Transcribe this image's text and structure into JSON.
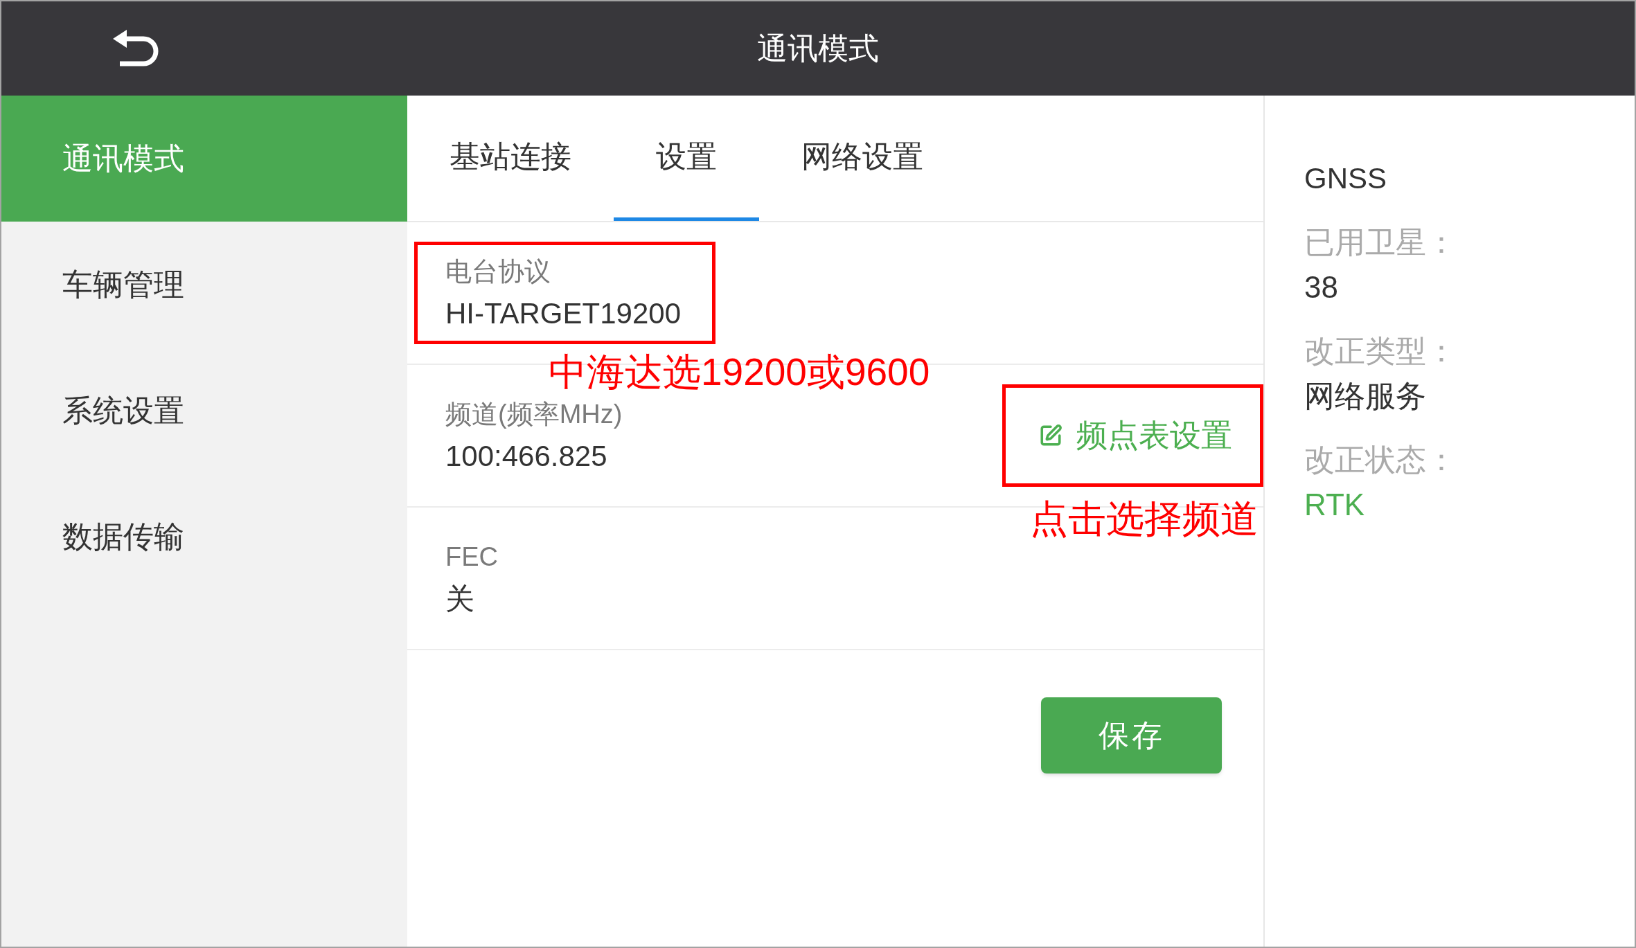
{
  "header": {
    "title": "通讯模式"
  },
  "sidebar": {
    "items": [
      {
        "label": "通讯模式",
        "selected": true
      },
      {
        "label": "车辆管理",
        "selected": false
      },
      {
        "label": "系统设置",
        "selected": false
      },
      {
        "label": "数据传输",
        "selected": false
      }
    ]
  },
  "tabs": [
    {
      "label": "基站连接",
      "selected": false
    },
    {
      "label": "设置",
      "selected": true
    },
    {
      "label": "网络设置",
      "selected": false
    }
  ],
  "settings": [
    {
      "label": "电台协议",
      "value": "HI-TARGET19200",
      "highlighted": true,
      "note": "中海达选19200或9600"
    },
    {
      "label": "频道(频率MHz)",
      "value": "100:466.825",
      "highlighted": false,
      "action": {
        "label": "频点表设置",
        "highlighted": true,
        "note": "点击选择频道"
      }
    },
    {
      "label": "FEC",
      "value": "关",
      "highlighted": false
    }
  ],
  "save_button": {
    "label": "保存"
  },
  "status_panel": {
    "title": "GNSS",
    "fields": [
      {
        "label": "已用卫星：",
        "value": "38",
        "color": "#333333"
      },
      {
        "label": "改正类型：",
        "value": "网络服务",
        "color": "#333333"
      },
      {
        "label": "改正状态：",
        "value": "RTK",
        "color": "#4caf50"
      }
    ]
  }
}
